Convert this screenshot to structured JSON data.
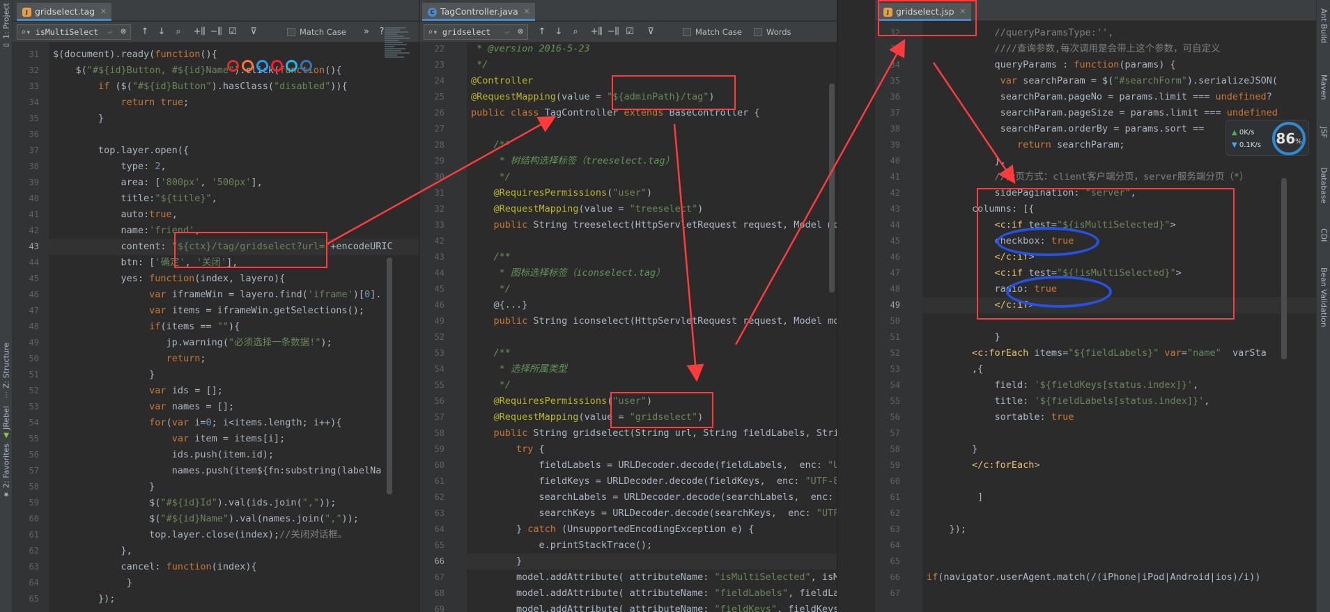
{
  "sidebar": {
    "left_tabs": [
      {
        "label": "1: Project",
        "icon": "folder-icon"
      },
      {
        "label": "Z: Structure",
        "icon": "structure-icon"
      },
      {
        "label": "JRebel",
        "icon": "jrebel-icon"
      },
      {
        "label": "2: Favorites",
        "icon": "star-icon"
      }
    ],
    "right_tabs": [
      "Ant Build",
      "Maven",
      "JSF",
      "Database",
      "CDI",
      "Bean Validation"
    ]
  },
  "panes": [
    {
      "tab": {
        "label": "gridselect.tag",
        "icon": "jsp-file-icon"
      },
      "search": "isMultiSelect",
      "match_case": "Match Case",
      "lines": [
        {
          "n": "31",
          "code": "$(document).ready(function(){"
        },
        {
          "n": "32",
          "code": "    $(\"#${id}Button, #${id}Name\").click(function(){"
        },
        {
          "n": "33",
          "code": "        if ($(\"#${id}Button\").hasClass(\"disabled\")){"
        },
        {
          "n": "34",
          "code": "            return true;"
        },
        {
          "n": "35",
          "code": "        }"
        },
        {
          "n": "36",
          "code": ""
        },
        {
          "n": "37",
          "code": "        top.layer.open({"
        },
        {
          "n": "38",
          "code": "            type: 2,"
        },
        {
          "n": "39",
          "code": "            area: ['800px', '500px'],"
        },
        {
          "n": "40",
          "code": "            title:\"${title}\","
        },
        {
          "n": "41",
          "code": "            auto:true,"
        },
        {
          "n": "42",
          "code": "            name:'friend',"
        },
        {
          "n": "43",
          "code": "            content: \"${ctx}/tag/gridselect?url=\"+encodeURIC"
        },
        {
          "n": "44",
          "code": "            btn: ['确定', '关闭'],"
        },
        {
          "n": "45",
          "code": "            yes: function(index, layero){"
        },
        {
          "n": "46",
          "code": "                 var iframeWin = layero.find('iframe')[0]."
        },
        {
          "n": "47",
          "code": "                 var items = iframeWin.getSelections();"
        },
        {
          "n": "48",
          "code": "                 if(items == \"\"){"
        },
        {
          "n": "49",
          "code": "                    jp.warning(\"必须选择一条数据!\");"
        },
        {
          "n": "50",
          "code": "                    return;"
        },
        {
          "n": "51",
          "code": "                 }"
        },
        {
          "n": "52",
          "code": "                 var ids = [];"
        },
        {
          "n": "53",
          "code": "                 var names = [];"
        },
        {
          "n": "54",
          "code": "                 for(var i=0; i<items.length; i++){"
        },
        {
          "n": "55",
          "code": "                     var item = items[i];"
        },
        {
          "n": "56",
          "code": "                     ids.push(item.id);"
        },
        {
          "n": "57",
          "code": "                     names.push(item${fn:substring(labelNa"
        },
        {
          "n": "58",
          "code": "                 }"
        },
        {
          "n": "59",
          "code": "                 $(\"#${id}Id\").val(ids.join(\",\"));"
        },
        {
          "n": "60",
          "code": "                 $(\"#${id}Name\").val(names.join(\",\"));"
        },
        {
          "n": "61",
          "code": "                 top.layer.close(index);//关闭对话框。"
        },
        {
          "n": "62",
          "code": "            },"
        },
        {
          "n": "63",
          "code": "            cancel: function(index){"
        },
        {
          "n": "64",
          "code": "             }"
        },
        {
          "n": "65",
          "code": "        });"
        }
      ]
    },
    {
      "tab": {
        "label": "TagController.java",
        "icon": "java-class-icon"
      },
      "search": "gridselect",
      "match_case": "Match Case",
      "words": "Words",
      "lines": [
        {
          "n": "22",
          "code": " * @version 2016-5-23"
        },
        {
          "n": "23",
          "code": " */"
        },
        {
          "n": "24",
          "code": "@Controller"
        },
        {
          "n": "25",
          "code": "@RequestMapping(value = \"${adminPath}/tag\")"
        },
        {
          "n": "26",
          "code": "public class TagController extends BaseController {"
        },
        {
          "n": "27",
          "code": ""
        },
        {
          "n": "28",
          "code": "    /**"
        },
        {
          "n": "29",
          "code": "     * 树结构选择标签（treeselect.tag）"
        },
        {
          "n": "30",
          "code": "     */"
        },
        {
          "n": "31",
          "code": "    @RequiresPermissions(\"user\")"
        },
        {
          "n": "32",
          "code": "    @RequestMapping(value = \"treeselect\")"
        },
        {
          "n": "33",
          "code": "    public String treeselect(HttpServletRequest request, Model mod"
        },
        {
          "n": "42",
          "code": ""
        },
        {
          "n": "43",
          "code": "    /**"
        },
        {
          "n": "44",
          "code": "     * 图标选择标签（iconselect.tag）"
        },
        {
          "n": "45",
          "code": "     */"
        },
        {
          "n": "46",
          "code": "    @{...}"
        },
        {
          "n": "49",
          "code": "    public String iconselect(HttpServletRequest request, Model mod"
        },
        {
          "n": "52",
          "code": ""
        },
        {
          "n": "53",
          "code": "    /**"
        },
        {
          "n": "54",
          "code": "     * 选择所属类型"
        },
        {
          "n": "55",
          "code": "     */"
        },
        {
          "n": "56",
          "code": "    @RequiresPermissions(\"user\")"
        },
        {
          "n": "57",
          "code": "    @RequestMapping(value = \"gridselect\")"
        },
        {
          "n": "58",
          "code": "    public String gridselect(String url, String fieldLabels, Strin"
        },
        {
          "n": "59",
          "code": "        try {"
        },
        {
          "n": "60",
          "code": "            fieldLabels = URLDecoder.decode(fieldLabels,  enc: \"UTF"
        },
        {
          "n": "61",
          "code": "            fieldKeys = URLDecoder.decode(fieldKeys,  enc: \"UTF-8\""
        },
        {
          "n": "62",
          "code": "            searchLabels = URLDecoder.decode(searchLabels,  enc: \""
        },
        {
          "n": "63",
          "code": "            searchKeys = URLDecoder.decode(searchKeys,  enc: \"UTF-8"
        },
        {
          "n": "64",
          "code": "        } catch (UnsupportedEncodingException e) {"
        },
        {
          "n": "65",
          "code": "            e.printStackTrace();"
        },
        {
          "n": "66",
          "code": "        }"
        },
        {
          "n": "67",
          "code": "        model.addAttribute( attributeName: \"isMultiSelected\", isMul"
        },
        {
          "n": "68",
          "code": "        model.addAttribute( attributeName: \"fieldLabels\", fieldLabe"
        },
        {
          "n": "69",
          "code": "        model.addAttribute( attributeName: \"fieldKeys\", fieldKeys.s"
        }
      ]
    },
    {
      "tab": {
        "label": "gridselect.jsp",
        "icon": "jsp-file-icon"
      },
      "lines": [
        {
          "n": "32",
          "code": "            //queryParamsType:'',"
        },
        {
          "n": "33",
          "code": "            ////查询参数,每次调用是会带上这个参数，可自定义"
        },
        {
          "n": "34",
          "code": "            queryParams : function(params) {"
        },
        {
          "n": "35",
          "code": "             var searchParam = $(\"#searchForm\").serializeJSON("
        },
        {
          "n": "36",
          "code": "             searchParam.pageNo = params.limit === undefined?"
        },
        {
          "n": "37",
          "code": "             searchParam.pageSize = params.limit === undefined"
        },
        {
          "n": "38",
          "code": "             searchParam.orderBy = params.sort == "
        },
        {
          "n": "39",
          "code": "                return searchParam;"
        },
        {
          "n": "40",
          "code": "            },"
        },
        {
          "n": "41",
          "code": "            //分页方式：client客户端分页，server服务端分页（*）"
        },
        {
          "n": "42",
          "code": "            sidePagination: \"server\","
        },
        {
          "n": "43",
          "code": "        columns: [{"
        },
        {
          "n": "44",
          "code": "            <c:if test=\"${isMultiSelected}\">"
        },
        {
          "n": "45",
          "code": "            checkbox: true"
        },
        {
          "n": "46",
          "code": "            </c:if>"
        },
        {
          "n": "47",
          "code": "            <c:if test=\"${!isMultiSelected}\">"
        },
        {
          "n": "48",
          "code": "            radio: true"
        },
        {
          "n": "49",
          "code": "            </c:if>"
        },
        {
          "n": "50",
          "code": ""
        },
        {
          "n": "51",
          "code": "            }"
        },
        {
          "n": "52",
          "code": "        <c:forEach items=\"${fieldLabels}\" var=\"name\"  varSta"
        },
        {
          "n": "53",
          "code": "        ,{"
        },
        {
          "n": "54",
          "code": "            field: '${fieldKeys[status.index]}',"
        },
        {
          "n": "55",
          "code": "            title: '${fieldLabels[status.index]}',"
        },
        {
          "n": "56",
          "code": "            sortable: true"
        },
        {
          "n": "57",
          "code": ""
        },
        {
          "n": "58",
          "code": "        }"
        },
        {
          "n": "59",
          "code": "        </c:forEach>"
        },
        {
          "n": "60",
          "code": ""
        },
        {
          "n": "61",
          "code": "         ]"
        },
        {
          "n": "62",
          "code": ""
        },
        {
          "n": "63",
          "code": "    });"
        },
        {
          "n": "64",
          "code": ""
        },
        {
          "n": "65",
          "code": ""
        },
        {
          "n": "66",
          "code": "if(navigator.userAgent.match(/(iPhone|iPod|Android|ios)/i))"
        },
        {
          "n": "67",
          "code": ""
        }
      ]
    }
  ],
  "network_widget": {
    "percent": "86",
    "unit": "%",
    "upload": "0K/s",
    "download": "0.1K/s"
  },
  "colors": {
    "annotation_red": "#ff3b3b",
    "annotation_blue": "#2452e6",
    "editor_bg": "#2b2b2b",
    "accent": "#4a88c7"
  }
}
